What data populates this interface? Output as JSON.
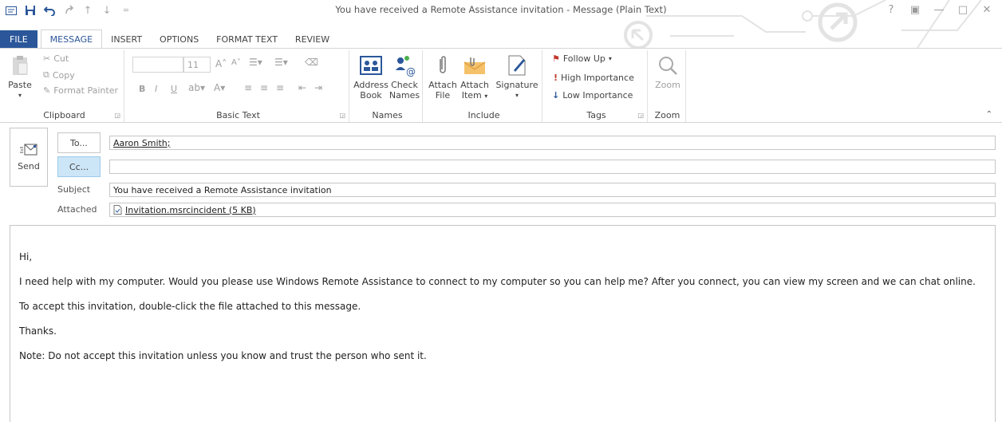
{
  "window": {
    "title": "You have received a Remote Assistance invitation - Message (Plain Text)",
    "controls": {
      "help": "?",
      "restore_ribbon": "▣",
      "minimize": "—",
      "maximize": "□",
      "close": "✕"
    }
  },
  "qat": {
    "app_icon": "envelope-icon",
    "save": "save-icon",
    "undo": "undo-icon",
    "redo": "redo-icon",
    "up": "arrow-up-icon",
    "down": "arrow-down-icon",
    "customize": "customize-icon"
  },
  "tabs": [
    {
      "label": "FILE"
    },
    {
      "label": "MESSAGE"
    },
    {
      "label": "INSERT"
    },
    {
      "label": "OPTIONS"
    },
    {
      "label": "FORMAT TEXT"
    },
    {
      "label": "REVIEW"
    }
  ],
  "ribbon": {
    "clipboard": {
      "label": "Clipboard",
      "paste": "Paste",
      "cut": "Cut",
      "copy": "Copy",
      "format_painter": "Format Painter"
    },
    "basic_text": {
      "label": "Basic Text",
      "font_name": "",
      "font_size": "11",
      "bold": "B",
      "italic": "I",
      "underline": "U",
      "grow": "A˄",
      "shrink": "A˅"
    },
    "names": {
      "label": "Names",
      "address_book_1": "Address",
      "address_book_2": "Book",
      "check_names_1": "Check",
      "check_names_2": "Names"
    },
    "include": {
      "label": "Include",
      "attach_file_1": "Attach",
      "attach_file_2": "File",
      "attach_item_1": "Attach",
      "attach_item_2": "Item",
      "signature": "Signature"
    },
    "tags": {
      "label": "Tags",
      "follow_up": "Follow Up",
      "high_importance": "High Importance",
      "low_importance": "Low Importance"
    },
    "zoom": {
      "label": "Zoom",
      "zoom_button": "Zoom"
    }
  },
  "message": {
    "send": "Send",
    "to_button": "To...",
    "cc_button": "Cc...",
    "to_value": "Aaron Smith;",
    "cc_value": "",
    "subject_label": "Subject",
    "subject_value": "You have received a Remote Assistance invitation",
    "attached_label": "Attached",
    "attachment": "Invitation.msrcincident (5 KB)"
  },
  "body": {
    "greeting": "Hi,",
    "paragraph1": "I need help with my computer. Would you please use Windows Remote Assistance to connect to my computer so you can help me? After you connect, you can view my screen and we can chat online.",
    "paragraph2": "To accept this invitation, double-click the file attached to this message.",
    "thanks": "Thanks.",
    "note": "Note:  Do not accept this invitation unless you know and trust the person who sent it."
  },
  "colors": {
    "accent": "#2b579a",
    "cc_highlight": "#cde6f7",
    "follow_up_flag": "#c0392b",
    "high_importance": "#c0392b",
    "low_importance": "#2b579a"
  }
}
